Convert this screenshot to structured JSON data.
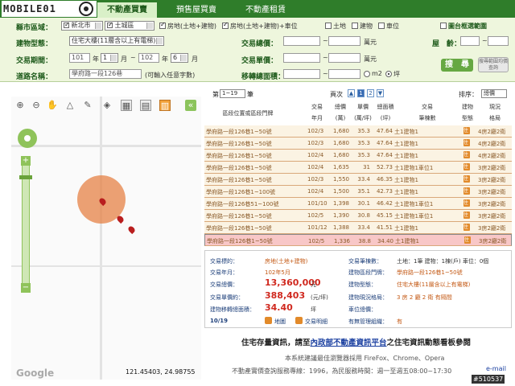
{
  "header": {
    "logo_text": "MOBILE01",
    "tabs": [
      {
        "label": "不動產買賣",
        "active": true
      },
      {
        "label": "預售屋買賣",
        "active": false
      },
      {
        "label": "不動產租賃",
        "active": false
      }
    ]
  },
  "form": {
    "city_label": "縣市區域：",
    "city_value": "新北市",
    "district_value": "土城區",
    "checks": [
      {
        "label": "房地(土地+建物)",
        "checked": true
      },
      {
        "label": "房地(土地+建物)+車位",
        "checked": true
      },
      {
        "label": "土地",
        "checked": false
      },
      {
        "label": "建物",
        "checked": false
      },
      {
        "label": "車位",
        "checked": false
      }
    ],
    "map_range_label": "圖台框選範圍",
    "building_type_label": "建物型態：",
    "building_type_value": "住宅大樓(11層含以上有電梯)",
    "total_price_label": "交易總價：",
    "unit_wan": "萬元",
    "age_label": "屋　齡：",
    "period_label": "交易期間：",
    "period_from_year": "101",
    "period_from_month": "1",
    "period_to_year": "102",
    "period_to_month": "6",
    "year_text": "年",
    "month_text": "月",
    "to_text": "~",
    "unit_price_label": "交易單價：",
    "road_label": "道路名稱：",
    "road_value": "學府路一段126巷",
    "road_hint": "(可輸入任意字數)",
    "area_label": "移轉總面積：",
    "unit_m2": "m2",
    "unit_ping": "坪",
    "search_button": "搜　尋",
    "guide_button": "搜尋範圍均價查詢"
  },
  "map": {
    "icons": [
      "zoom-in-icon",
      "zoom-out-icon",
      "hand-icon",
      "measure-icon",
      "marker-icon",
      "layer-icon",
      "print-icon",
      "table-icon",
      "chart-icon"
    ],
    "collapse": "«",
    "zoom_plus": "+",
    "zoom_minus": "−",
    "google": "Google",
    "coords": "121.45403, 24.98755"
  },
  "results": {
    "page_prefix": "第",
    "page_select": "1~19",
    "page_suffix": "筆",
    "pages_label": "頁次",
    "pages": [
      "1",
      "2"
    ],
    "current_page": "1",
    "sort_label": "排序：",
    "sort_value": "總價",
    "columns": {
      "address": "區段位置或區段門牌",
      "date_1": "交易",
      "date_2": "年月",
      "total_1": "總價",
      "total_2": "(萬)",
      "unit_1": "單價",
      "unit_2": "(萬/坪)",
      "area_1": "總面積",
      "area_2": "(坪)",
      "count_1": "交易",
      "count_2": "筆棟數",
      "type_1": "建物",
      "type_2": "型態",
      "layout_1": "現況",
      "layout_2": "格局"
    },
    "rows": [
      {
        "address": "學府路一段126巷1~50號",
        "date": "102/3",
        "total": "1,680",
        "unit": "35.3",
        "area": "47.64",
        "count": "土1建物1",
        "type_icon": "住",
        "layout": "4房2廳2衛"
      },
      {
        "address": "學府路一段126巷1~50號",
        "date": "102/3",
        "total": "1,680",
        "unit": "35.3",
        "area": "47.64",
        "count": "土1建物1",
        "type_icon": "住",
        "layout": "4房2廳2衛"
      },
      {
        "address": "學府路一段126巷1~50號",
        "date": "102/4",
        "total": "1,680",
        "unit": "35.3",
        "area": "47.64",
        "count": "土1建物1",
        "type_icon": "住",
        "layout": "4房2廳2衛"
      },
      {
        "address": "學府路一段126巷1~50號",
        "date": "102/4",
        "total": "1,635",
        "unit": "31",
        "area": "52.73",
        "count": "土1建物1車位1",
        "type_icon": "住",
        "layout": "3房2廳2衛"
      },
      {
        "address": "學府路一段126巷1~50號",
        "date": "102/3",
        "total": "1,550",
        "unit": "33.4",
        "area": "46.35",
        "count": "土1建物1",
        "type_icon": "住",
        "layout": "3房2廳2衛"
      },
      {
        "address": "學府路一段126巷1~100號",
        "date": "102/4",
        "total": "1,500",
        "unit": "35.1",
        "area": "42.73",
        "count": "土1建物1",
        "type_icon": "住",
        "layout": "3房2廳2衛"
      },
      {
        "address": "學府路一段126巷51~100號",
        "date": "101/10",
        "total": "1,398",
        "unit": "30.1",
        "area": "46.42",
        "count": "土1建物1車位1",
        "type_icon": "住",
        "layout": "3房2廳2衛"
      },
      {
        "address": "學府路一段126巷1~50號",
        "date": "102/5",
        "total": "1,390",
        "unit": "30.8",
        "area": "45.15",
        "count": "土1建物1車位1",
        "type_icon": "住",
        "layout": "3房2廳2衛"
      },
      {
        "address": "學府路一段126巷1~50號",
        "date": "101/12",
        "total": "1,388",
        "unit": "33.4",
        "area": "41.51",
        "count": "土1建物1",
        "type_icon": "住",
        "layout": "3房2廳2衛"
      },
      {
        "address": "學府路一段126巷1~50號",
        "date": "102/5",
        "total": "1,336",
        "unit": "38.8",
        "area": "34.40",
        "count": "土1建物1",
        "type_icon": "住",
        "layout": "3房2廳2衛"
      }
    ]
  },
  "detail": {
    "target_label": "交易標的：",
    "target_value": "房地(土地+建物)",
    "count_label": "交易筆棟數：",
    "count_value": "土地：1筆 建物：1棟(戶) 車位：0個",
    "date_label": "交易年月：",
    "date_value": "102年5月",
    "address_label": "建物區段門牌：",
    "address_value": "學府路一段126巷1~50號",
    "total_label": "交易總價：",
    "total_value": "13,360,000",
    "total_unit": "元",
    "type_label": "建物型態：",
    "type_value": "住宅大樓(11層含以上有電梯)",
    "unit_label": "交易單價約：",
    "unit_value": "388,403",
    "unit_unit": "(元/坪)",
    "layout_label": "建物現況格局：",
    "layout_value": "3 房 2 廳 2 衛 有隔間",
    "area_label": "建物移轉總面積：",
    "area_value": "34.40",
    "area_unit": "坪",
    "parking_label": "車位總價：",
    "mgmt_label": "有無管理組織：",
    "mgmt_value": "有",
    "index": "10/19",
    "map_btn": "地圖",
    "detail_btn": "交易明細"
  },
  "footer": {
    "notice_pre": "住宅存量資訊，請至",
    "notice_link": "內政部不動產資訊平台",
    "notice_post": "之住宅資訊動態看板參閱",
    "browser": "本系統建議最佳瀏覽器採用 FireFox、Chrome、Opera",
    "service": "不動產實價查詢服務專線：1996，為民服務時間：週一至週五08:00~17:30",
    "email": "e-mail",
    "watermark": "#510537"
  },
  "colors": {
    "brand_green": "#2f7d2a",
    "form_bg": "#eef6dd",
    "row_bg": "#fbf3e3",
    "row_selected": "#f8c7c7",
    "price_red": "#d0291f"
  }
}
